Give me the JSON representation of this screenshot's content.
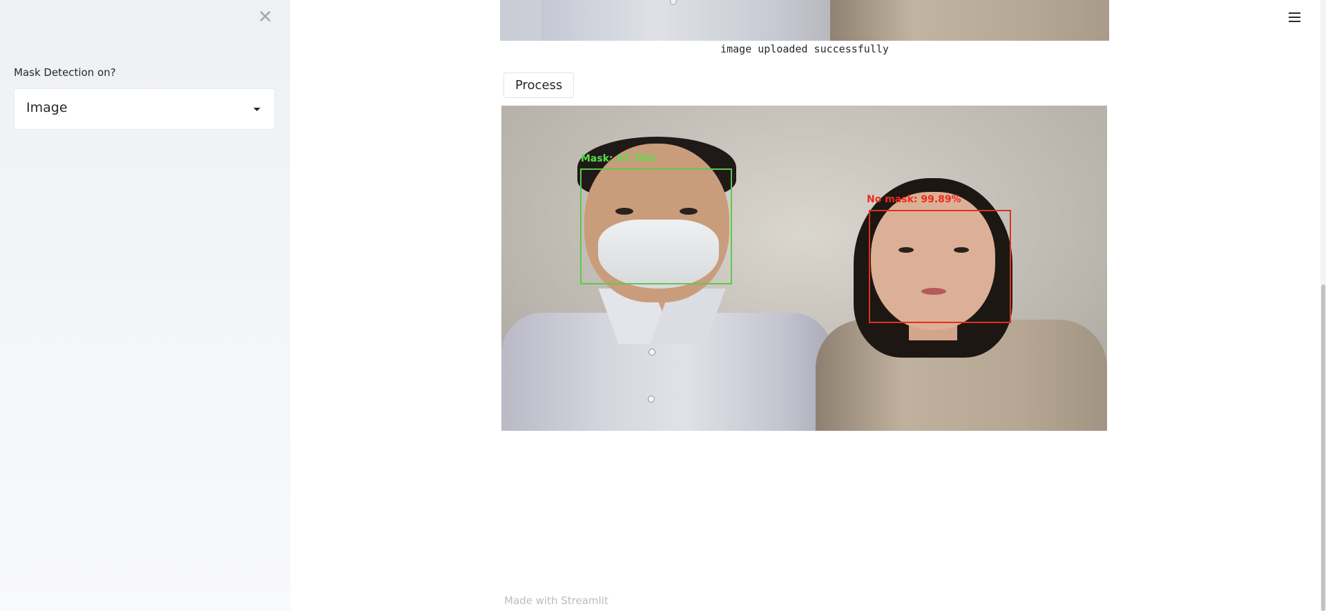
{
  "sidebar": {
    "close_icon": "close-icon",
    "label": "Mask Detection on?",
    "select": {
      "value": "Image",
      "caret_icon": "chevron-down-icon"
    }
  },
  "main": {
    "upload_caption": "image uploaded successfully",
    "process_button": "Process",
    "detections": [
      {
        "label": "Mask: 97.76%",
        "color": "#5fc84b"
      },
      {
        "label": "No mask: 99.89%",
        "color": "#e0301e"
      }
    ],
    "footer": "Made with Streamlit",
    "menu_icon": "hamburger-menu-icon"
  },
  "colors": {
    "sidebar_bg": "#eef1f4",
    "text": "#262730",
    "footer_text": "#b9bbc3"
  }
}
